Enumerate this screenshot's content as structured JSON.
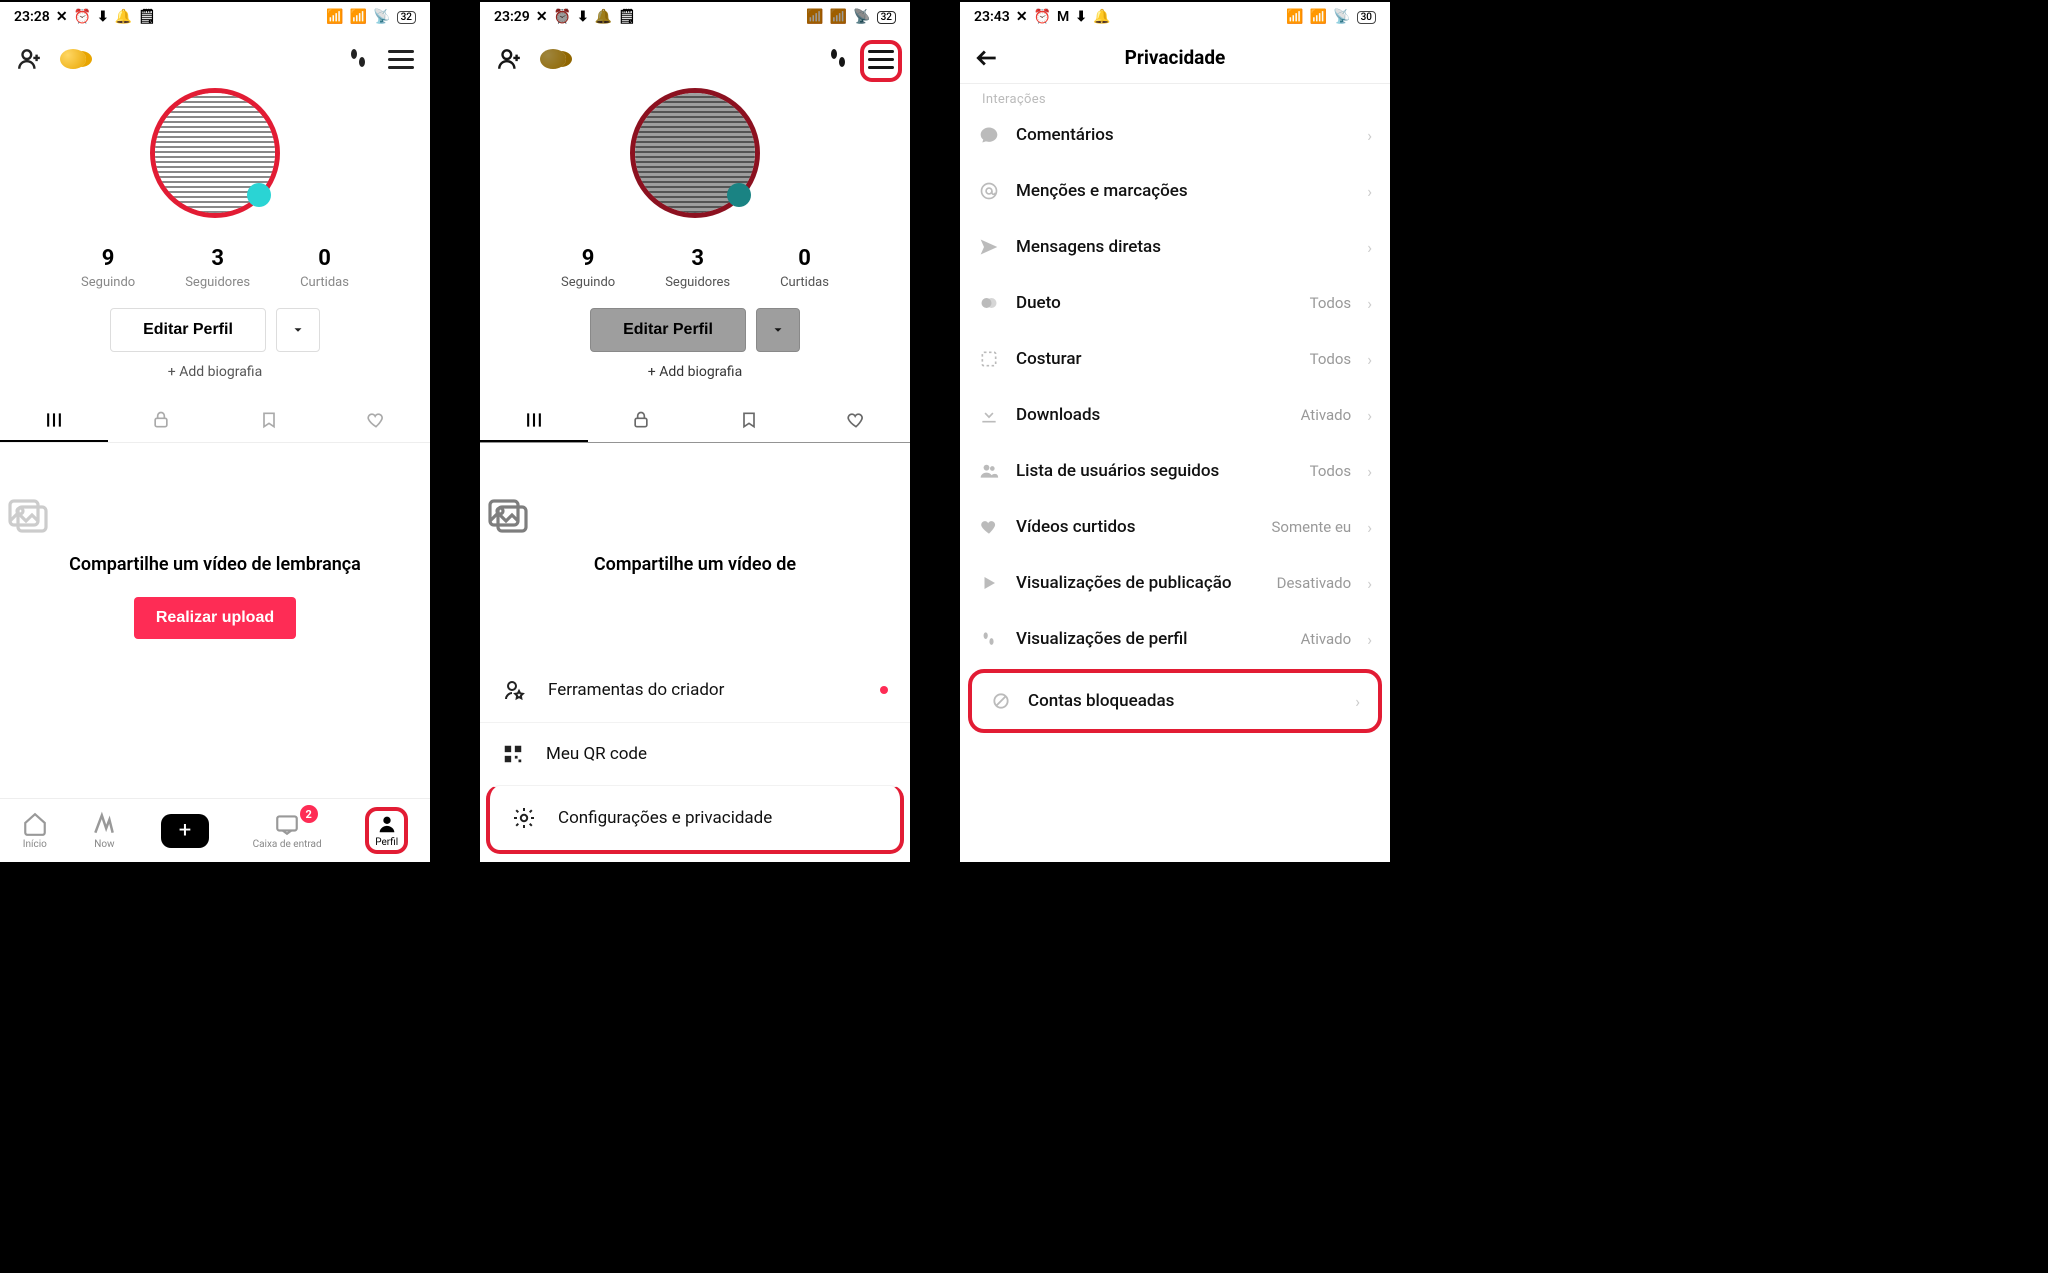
{
  "screen1": {
    "status": {
      "time": "23:28",
      "battery": "32"
    },
    "stats": {
      "following_num": "9",
      "following_lbl": "Seguindo",
      "followers_num": "3",
      "followers_lbl": "Seguidores",
      "likes_num": "0",
      "likes_lbl": "Curtidas"
    },
    "edit": "Editar Perfil",
    "add_bio": "+ Add biografia",
    "empty_title": "Compartilhe um vídeo de lembrança",
    "upload": "Realizar upload",
    "nav": {
      "home": "Início",
      "now": "Now",
      "inbox": "Caixa de entrad",
      "inbox_badge": "2",
      "profile": "Perfil"
    }
  },
  "screen2": {
    "status": {
      "time": "23:29",
      "battery": "32"
    },
    "stats": {
      "following_num": "9",
      "following_lbl": "Seguindo",
      "followers_num": "3",
      "followers_lbl": "Seguidores",
      "likes_num": "0",
      "likes_lbl": "Curtidas"
    },
    "edit": "Editar Perfil",
    "add_bio": "+ Add biografia",
    "empty_title": "Compartilhe um vídeo de",
    "sheet": {
      "creator_tools": "Ferramentas do criador",
      "qr": "Meu QR code",
      "settings": "Configurações e privacidade"
    }
  },
  "screen3": {
    "status": {
      "time": "23:43",
      "battery": "30"
    },
    "title": "Privacidade",
    "section_hint": "Interações",
    "items": {
      "comments": "Comentários",
      "mentions": "Menções e marcações",
      "dm": "Mensagens diretas",
      "duet": "Dueto",
      "stitch": "Costurar",
      "downloads": "Downloads",
      "following_list": "Lista de usuários seguidos",
      "liked": "Vídeos curtidos",
      "post_views": "Visualizações de publicação",
      "profile_views": "Visualizações de perfil",
      "blocked": "Contas bloqueadas"
    },
    "values": {
      "duet": "Todos",
      "stitch": "Todos",
      "downloads": "Ativado",
      "following_list": "Todos",
      "liked": "Somente eu",
      "post_views": "Desativado",
      "profile_views": "Ativado"
    }
  }
}
